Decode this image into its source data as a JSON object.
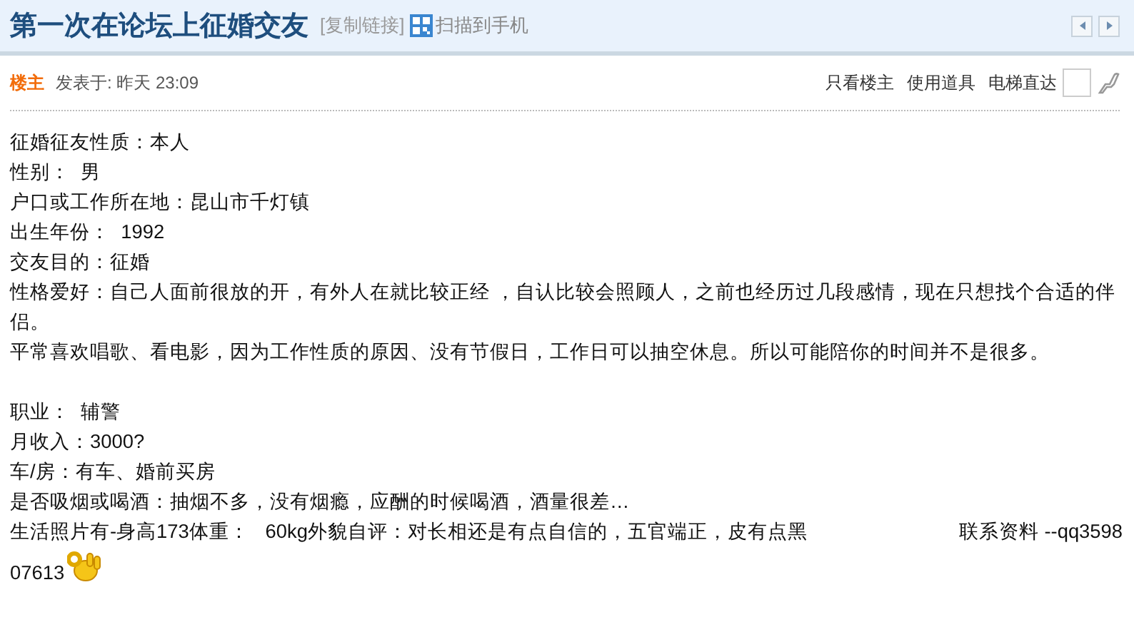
{
  "thread": {
    "title": "第一次在论坛上征婚交友",
    "copy_link": "[复制链接]",
    "scan_to_phone": "扫描到手机"
  },
  "post_header": {
    "author_badge": "楼主",
    "posted": "发表于: 昨天 23:09",
    "actions": [
      "只看楼主",
      "使用道具"
    ],
    "jump_label": "电梯直达"
  },
  "body": [
    {
      "kind": "line",
      "text": "征婚征友性质：本人"
    },
    {
      "kind": "line",
      "text": "性别：  男"
    },
    {
      "kind": "line",
      "text": "户口或工作所在地：昆山市千灯镇"
    },
    {
      "kind": "line",
      "text": "出生年份：  1992"
    },
    {
      "kind": "line",
      "text": "交友目的：征婚"
    },
    {
      "kind": "line",
      "text": "性格爱好：自己人面前很放的开，有外人在就比较正经 ，自认比较会照顾人，之前也经历过几段感情，现在只想找个合适的伴侣。"
    },
    {
      "kind": "line",
      "text": "平常喜欢唱歌、看电影，因为工作性质的原因、没有节假日，工作日可以抽空休息。所以可能陪你的时间并不是很多。"
    },
    {
      "kind": "blank"
    },
    {
      "kind": "line",
      "text": "职业：  辅警"
    },
    {
      "kind": "line",
      "text": "月收入：3000?"
    },
    {
      "kind": "line",
      "text": "车/房：有车、婚前买房"
    },
    {
      "kind": "line",
      "text": "是否吸烟或喝酒：抽烟不多，没有烟瘾，应酬的时候喝酒，酒量很差…"
    },
    {
      "kind": "closing",
      "text": "生活照片有-身高173体重：   60kg外貌自评：对长相还是有点自信的，五官端正，皮有点黑",
      "contact": "联系资料 --qq3598",
      "contact_continued": "07613"
    }
  ]
}
